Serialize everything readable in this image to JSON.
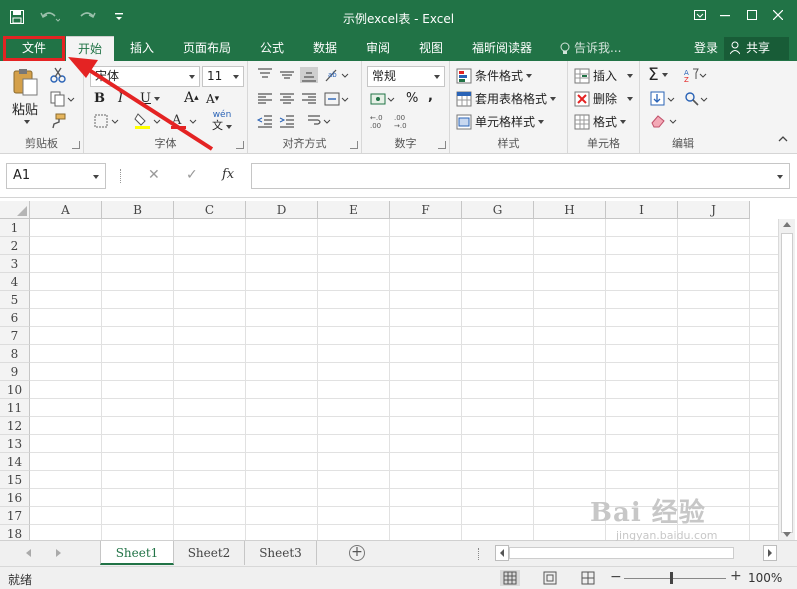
{
  "window": {
    "title": "示例excel表 - Excel"
  },
  "tabs": {
    "file": "文件",
    "home": "开始",
    "insert": "插入",
    "page_layout": "页面布局",
    "formulas": "公式",
    "data": "数据",
    "review": "审阅",
    "view": "视图",
    "reader": "福昕阅读器",
    "tell_me": "告诉我...",
    "login": "登录",
    "share": "共享"
  },
  "ribbon": {
    "clipboard": {
      "paste": "粘贴",
      "label": "剪贴板"
    },
    "font": {
      "name": "宋体",
      "size": "11",
      "label": "字体",
      "phonetic": "wén"
    },
    "alignment": {
      "label": "对齐方式"
    },
    "number": {
      "format": "常规",
      "label": "数字"
    },
    "styles": {
      "conditional": "条件格式",
      "table": "套用表格格式",
      "cell_styles": "单元格样式",
      "label": "样式"
    },
    "cells": {
      "insert": "插入",
      "delete": "删除",
      "format": "格式",
      "label": "单元格"
    },
    "editing": {
      "label": "编辑"
    }
  },
  "formula_bar": {
    "name_box": "A1",
    "fx": "fx",
    "value": ""
  },
  "grid": {
    "columns": [
      "A",
      "B",
      "C",
      "D",
      "E",
      "F",
      "G",
      "H",
      "I",
      "J"
    ],
    "rows": [
      "1",
      "2",
      "3",
      "4",
      "5",
      "6",
      "7",
      "8",
      "9",
      "10",
      "11",
      "12",
      "13",
      "14",
      "15",
      "16",
      "17",
      "18"
    ]
  },
  "sheets": [
    "Sheet1",
    "Sheet2",
    "Sheet3"
  ],
  "active_sheet": "Sheet1",
  "status": {
    "ready": "就绪",
    "zoom": "100%"
  },
  "watermark": {
    "text": "Bai 经验",
    "url": "jingyan.baidu.com"
  },
  "colors": {
    "excel_green": "#217346",
    "highlight_red": "#e42323"
  }
}
